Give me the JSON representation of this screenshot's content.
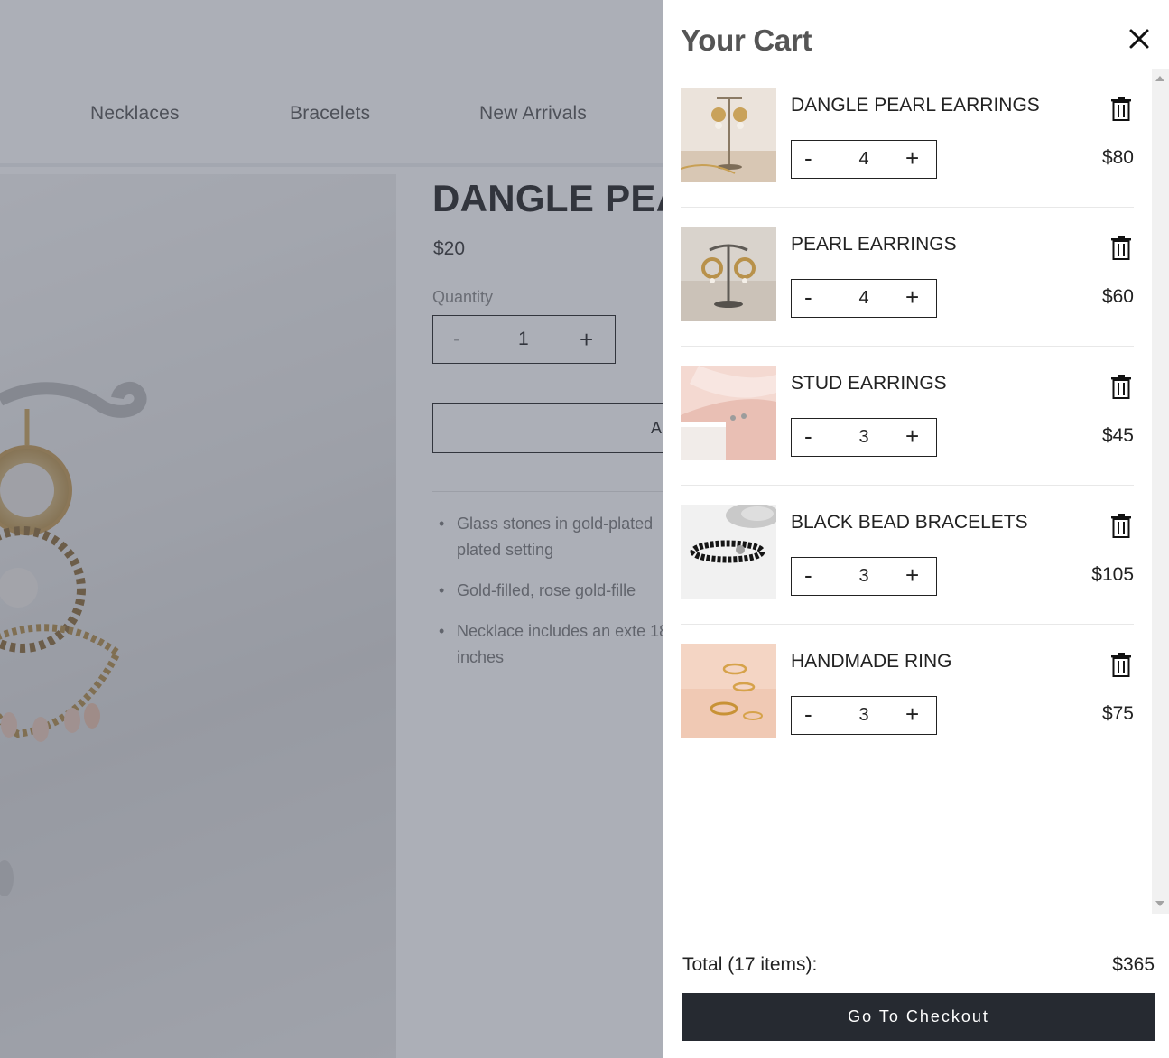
{
  "nav": {
    "items": [
      {
        "label": "Necklaces"
      },
      {
        "label": "Bracelets"
      },
      {
        "label": "New Arrivals"
      }
    ]
  },
  "product": {
    "title": "DANGLE PEA",
    "price": "$20",
    "quantity_label": "Quantity",
    "quantity_minus": "-",
    "quantity_value": "1",
    "quantity_plus": "+",
    "add_button_label": "A",
    "bullets": [
      "Glass stones in gold-plated plated setting",
      "Gold-filled, rose gold-fille",
      "Necklace includes an exte 18 inches"
    ]
  },
  "cart": {
    "title": "Your Cart",
    "items": [
      {
        "name": "DANGLE PEARL EARRINGS",
        "quantity": "4",
        "price": "$80",
        "minus": "-",
        "plus": "+",
        "thumb": "pearl-earrings-photo"
      },
      {
        "name": "PEARL EARRINGS",
        "quantity": "4",
        "price": "$60",
        "minus": "-",
        "plus": "+",
        "thumb": "earrings-on-stand-photo"
      },
      {
        "name": "STUD EARRINGS",
        "quantity": "3",
        "price": "$45",
        "minus": "-",
        "plus": "+",
        "thumb": "stud-earrings-photo"
      },
      {
        "name": "BLACK BEAD BRACELETS",
        "quantity": "3",
        "price": "$105",
        "minus": "-",
        "plus": "+",
        "thumb": "bead-bracelet-photo"
      },
      {
        "name": "HANDMADE RING",
        "quantity": "3",
        "price": "$75",
        "minus": "-",
        "plus": "+",
        "thumb": "gold-rings-photo"
      }
    ],
    "total_label": "Total (17 items):",
    "total_value": "$365",
    "checkout_label": "Go To Checkout"
  },
  "colors": {
    "overlay": "#464e5f",
    "checkout_button": "#262a31",
    "text": "#222222"
  }
}
